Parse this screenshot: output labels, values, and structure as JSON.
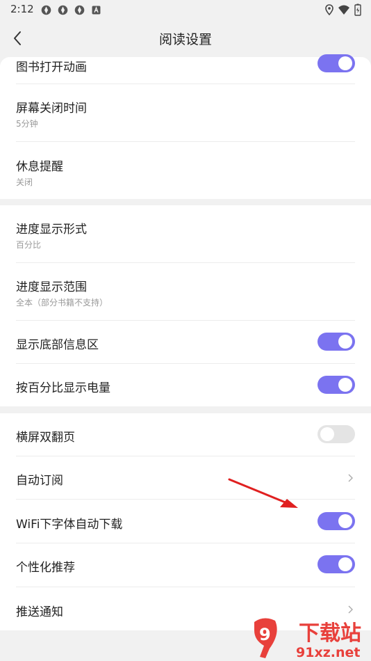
{
  "status_bar": {
    "time": "2:12"
  },
  "header": {
    "title": "阅读设置"
  },
  "section1": {
    "rows": [
      {
        "title": "图书打开动画",
        "toggle": "on"
      },
      {
        "title": "屏幕关闭时间",
        "subtitle": "5分钟"
      },
      {
        "title": "休息提醒",
        "subtitle": "关闭"
      }
    ]
  },
  "section2": {
    "rows": [
      {
        "title": "进度显示形式",
        "subtitle": "百分比"
      },
      {
        "title": "进度显示范围",
        "subtitle": "全本（部分书籍不支持）"
      },
      {
        "title": "显示底部信息区",
        "toggle": "on"
      },
      {
        "title": "按百分比显示电量",
        "toggle": "on"
      }
    ]
  },
  "section3": {
    "rows": [
      {
        "title": "横屏双翻页",
        "toggle": "off"
      },
      {
        "title": "自动订阅",
        "control": "chevron-right"
      },
      {
        "title": "WiFi下字体自动下载",
        "toggle": "on"
      },
      {
        "title": "个性化推荐",
        "toggle": "on"
      },
      {
        "title": "推送通知",
        "control": "chevron-right"
      }
    ]
  },
  "watermark": {
    "brand": "下载站",
    "domain": "91xz.net",
    "logo": "9"
  },
  "colors": {
    "toggle_on": "#7b73f0",
    "toggle_off": "#e4e4e4",
    "background": "#f1f1f1",
    "arrow": "#e02020"
  }
}
